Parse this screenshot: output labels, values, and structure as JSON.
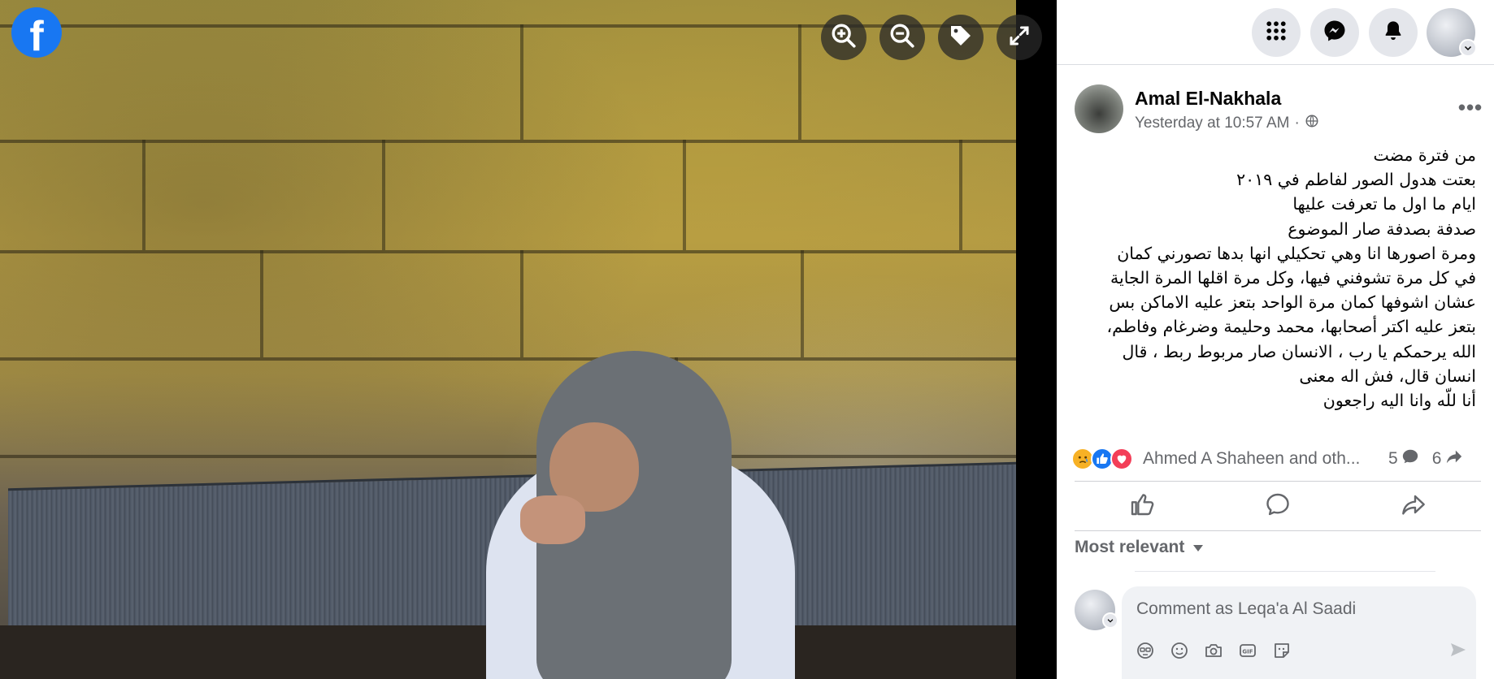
{
  "app": {
    "logo_letter": "f"
  },
  "viewer": {
    "zoom_in_icon": "zoom-in-icon",
    "zoom_out_icon": "zoom-out-icon",
    "tag_icon": "tag-icon",
    "fullscreen_icon": "expand-icon"
  },
  "topbar": {
    "icons": [
      "menu-grid-icon",
      "messenger-icon",
      "bell-icon",
      "account-avatar"
    ]
  },
  "post": {
    "author": "Amal El-Nakhala",
    "time": "Yesterday at 10:57 AM",
    "time_separator": "·",
    "privacy_icon": "globe-icon",
    "more_label": "•••",
    "body_lines": [
      "من فترة مضت",
      "بعتت هدول الصور لفاطم في ٢٠١٩",
      "ايام ما اول ما تعرفت عليها",
      "صدفة بصدفة صار الموضوع",
      "ومرة اصورها انا وهي تحكيلي انها بدها تصورني كمان",
      "في كل مرة تشوفني فيها، وكل مرة اقلها المرة الجاية",
      "عشان اشوفها كمان مرة الواحد بتعز عليه الاماكن بس",
      "بتعز عليه اكتر أصحابها، محمد وحليمة وضرغام وفاطم،",
      "الله يرحمكم يا رب ، الانسان صار مربوط ربط ، قال",
      "انسان قال، فش اله معنى",
      "أنا للّه وانا اليه راجعون"
    ]
  },
  "reactions": {
    "icons": [
      "sad-reaction-icon",
      "like-reaction-icon",
      "love-reaction-icon"
    ],
    "names": "Ahmed A Shaheen and oth...",
    "comments_count": "5",
    "shares_count": "6"
  },
  "actions": [
    "like-action",
    "comment-action",
    "share-action"
  ],
  "comments": {
    "sort_label": "Most relevant",
    "placeholder": "Comment as Leqa'a Al Saadi"
  },
  "colors": {
    "brand": "#1877f2",
    "love": "#f33e58",
    "sad": "#f7b125"
  }
}
